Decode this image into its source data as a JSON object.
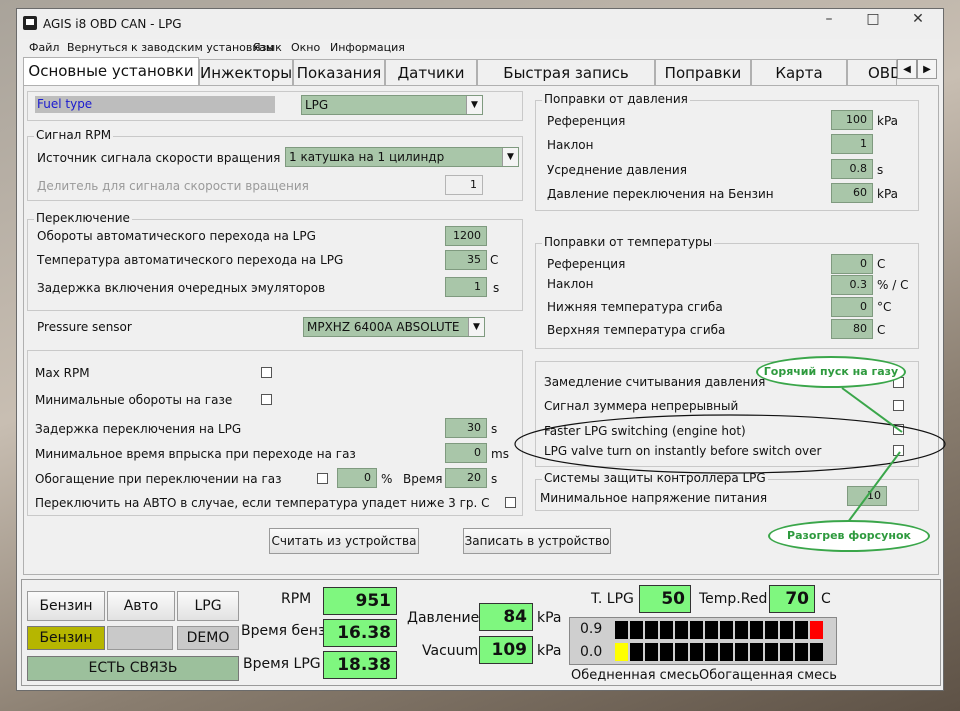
{
  "window": {
    "title": "AGIS i8 OBD CAN - LPG",
    "minimize": "–",
    "maximize": "□",
    "close": "✕"
  },
  "menu": [
    "Файл",
    "Вернуться к заводским установкам",
    "Язык",
    "Окно",
    "Информация"
  ],
  "tabs": [
    "Основные установки",
    "Инжекторы",
    "Показания",
    "Датчики",
    "Быстрая запись карты",
    "Поправки",
    "Карта",
    "OBD"
  ],
  "tab_nav": {
    "left": "◀",
    "right": "▶"
  },
  "fuel": {
    "label": "Fuel type",
    "value": "LPG"
  },
  "rpm_group": {
    "title": "Сигнал RPM",
    "source_label": "Источник сигнала скорости вращения",
    "source_value": "1 катушка на 1 цилиндр",
    "divider_label": "Делитель для сигнала скорости вращения",
    "divider_value": "1"
  },
  "switch_group": {
    "title": "Переключение",
    "rows": [
      {
        "label": "Обороты автоматического перехода на LPG",
        "value": "1200",
        "unit": ""
      },
      {
        "label": "Температура автоматического перехода на LPG",
        "value": "35",
        "unit": "C"
      },
      {
        "label": "Задержка включения очередных эмуляторов",
        "value": "1",
        "unit": "s"
      }
    ]
  },
  "pressure_sensor": {
    "label": "Pressure sensor",
    "value": "MPXHZ 6400A ABSOLUTE"
  },
  "misc": {
    "max_rpm": "Max RPM",
    "min_rpm_gas": "Минимальные обороты на газе",
    "delay_label": "Задержка переключения на LPG",
    "delay_value": "30",
    "delay_unit": "s",
    "min_inj_label": "Минимальное время впрыска при переходе на газ",
    "min_inj_value": "0",
    "min_inj_unit": "ms",
    "enrich_label": "Обогащение при переключении на газ",
    "enrich_value": "0",
    "enrich_unit": "%",
    "time_label": "Время",
    "time_value": "20",
    "time_unit": "s",
    "auto_label": "Переключить на АВТО в случае, если температура упадет ниже 3 гр. С"
  },
  "buttons": {
    "read": "Считать из устройства",
    "write": "Записать в устройство"
  },
  "pressure_corr": {
    "title": "Поправки от давления",
    "rows": [
      {
        "label": "Референция",
        "value": "100",
        "unit": "kPa"
      },
      {
        "label": "Наклон",
        "value": "1",
        "unit": ""
      },
      {
        "label": "Усреднение давления",
        "value": "0.8",
        "unit": "s"
      },
      {
        "label": "Давление переключения на Бензин",
        "value": "60",
        "unit": "kPa"
      }
    ]
  },
  "temp_corr": {
    "title": "Поправки от температуры",
    "rows": [
      {
        "label": "Референция",
        "value": "0",
        "unit": "C"
      },
      {
        "label": "Наклон",
        "value": "0.3",
        "unit": "% / C"
      },
      {
        "label": "Нижняя температура сгиба",
        "value": "0",
        "unit": "°C"
      },
      {
        "label": "Верхняя температура сгиба",
        "value": "80",
        "unit": "C"
      }
    ]
  },
  "options": {
    "slow_read": "Замедление считывания давления",
    "buzzer": "Сигнал зуммера непрерывный",
    "faster": "Faster LPG switching (engine hot)",
    "valve": "LPG valve turn on instantly before switch over"
  },
  "protection": {
    "title": "Системы защиты контроллера LPG",
    "label": "Минимальное напряжение питания",
    "value": "10"
  },
  "annotations": {
    "hot_start": "Горячий пуск на газу",
    "injector_heat": "Разогрев форсунок"
  },
  "status": {
    "btn_petrol": "Бензин",
    "btn_auto": "Авто",
    "btn_lpg": "LPG",
    "ind_petrol": "Бензин",
    "ind_demo": "DEMO",
    "connection": "ЕСТЬ СВЯЗЬ",
    "rpm_label": "RPM",
    "rpm_value": "951",
    "petrol_time_label": "Время бенз.",
    "petrol_time_value": "16.38",
    "lpg_time_label": "Время LPG",
    "lpg_time_value": "18.38",
    "pressure_label": "Давление",
    "pressure_value": "84",
    "pressure_unit": "kPa",
    "vacuum_label": "Vacuum",
    "vacuum_value": "109",
    "vacuum_unit": "kPa",
    "tlpg_label": "T. LPG",
    "tlpg_value": "50",
    "tred_label": "Temp.Red",
    "tred_value": "70",
    "tred_unit": "C",
    "lambda1_value": "0.9",
    "lambda2_value": "0.0",
    "lean_label": "Обедненная смесь",
    "rich_label": "Обогащенная смесь",
    "lambda1_active_index": 13,
    "lambda2_active_index": 0
  },
  "colors": {
    "field_green": "#a9c6a9",
    "indicator_green": "#7ff77f",
    "annotation_green": "#3aa64a",
    "lambda_red": "#ff0000",
    "lambda_yellow": "#ffff00"
  }
}
